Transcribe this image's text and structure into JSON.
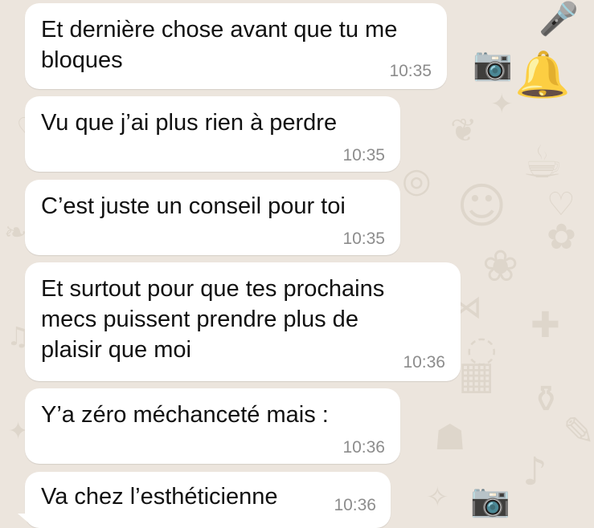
{
  "chat": {
    "messages": [
      {
        "text": "Et dernière chose avant que tu me\nbloques",
        "time": "10:35"
      },
      {
        "text": "Vu que j’ai plus rien à perdre",
        "time": "10:35"
      },
      {
        "text": "C’est juste un conseil pour toi",
        "time": "10:35"
      },
      {
        "text": "Et surtout pour que tes prochains\nmecs puissent prendre plus de\nplaisir que moi",
        "time": "10:36"
      },
      {
        "text": "Y’a zéro méchanceté mais :",
        "time": "10:36"
      },
      {
        "text": "Va chez l’esthéticienne",
        "time": "10:36"
      }
    ]
  },
  "colors": {
    "background": "#ece5dd",
    "bubble": "#ffffff",
    "text": "#111111",
    "timestamp": "#8c8c8c"
  }
}
